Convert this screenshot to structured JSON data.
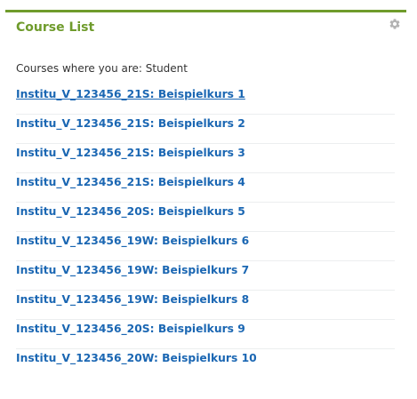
{
  "block": {
    "title": "Course List",
    "settings_icon": "gear-icon",
    "intro": "Courses where you are: Student"
  },
  "courses": [
    {
      "label": "Institu_V_123456_21S: Beispielkurs 1"
    },
    {
      "label": "Institu_V_123456_21S: Beispielkurs 2"
    },
    {
      "label": "Institu_V_123456_21S: Beispielkurs 3"
    },
    {
      "label": "Institu_V_123456_21S: Beispielkurs 4"
    },
    {
      "label": "Institu_V_123456_20S: Beispielkurs 5"
    },
    {
      "label": "Institu_V_123456_19W: Beispielkurs 6"
    },
    {
      "label": "Institu_V_123456_19W: Beispielkurs 7"
    },
    {
      "label": "Institu_V_123456_19W: Beispielkurs 8"
    },
    {
      "label": "Institu_V_123456_20S: Beispielkurs 9"
    },
    {
      "label": "Institu_V_123456_20W: Beispielkurs 10"
    }
  ],
  "colors": {
    "accent": "#6f9b2c",
    "link": "#1b67b3",
    "text": "#333333",
    "gear": "#b3b3b3"
  }
}
